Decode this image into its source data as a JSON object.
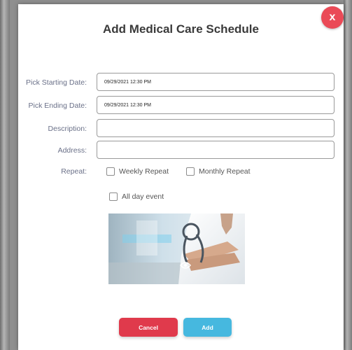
{
  "modal": {
    "title": "Add Medical Care Schedule",
    "close_label": "x",
    "fields": {
      "start_date": {
        "label": "Pick Starting Date:",
        "value": "09/29/2021 12:30 PM"
      },
      "end_date": {
        "label": "Pick Ending Date:",
        "value": "09/29/2021 12:30 PM"
      },
      "description": {
        "label": "Description:",
        "value": ""
      },
      "address": {
        "label": "Address:",
        "value": ""
      }
    },
    "repeat": {
      "label": "Repeat:",
      "weekly": "Weekly Repeat",
      "monthly": "Monthly Repeat"
    },
    "all_day": "All day event",
    "buttons": {
      "cancel": "Cancel",
      "add": "Add"
    }
  },
  "colors": {
    "close": "#ea4a57",
    "cancel": "#e03a4c",
    "add": "#46b8df",
    "label": "#6a7088"
  },
  "icons": {
    "photo_overlay": "eye-icon",
    "close": "close-icon"
  }
}
